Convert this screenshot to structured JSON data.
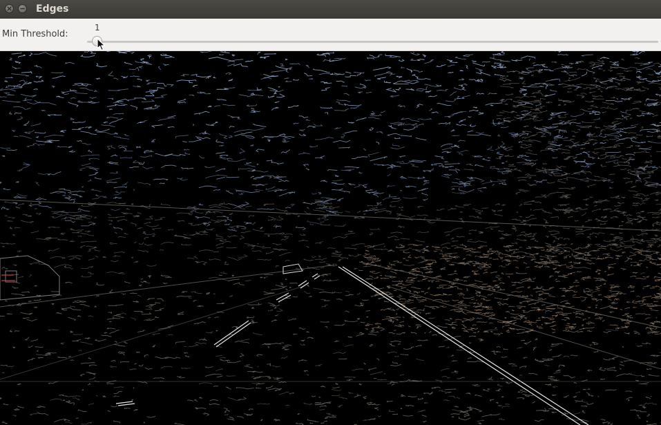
{
  "window": {
    "title": "Edges"
  },
  "controls": {
    "slider_label": "Min Threshold:",
    "slider_value": "1",
    "slider_min": 0,
    "slider_max": 255,
    "slider_fraction": 0.004
  },
  "icons": {
    "close": "close-icon",
    "minimize": "minimize-icon",
    "cursor": "mouse-pointer-icon"
  },
  "colors": {
    "titlebar": "#3b3a36",
    "control_bg": "#f2f1f0",
    "canvas_bg": "#000000",
    "sky_edges": "#8fa3c8",
    "ground_edges_warm": "#c9a88a",
    "ground_edges_dark": "#6d6a63",
    "lane_marks": "#ffffff"
  }
}
